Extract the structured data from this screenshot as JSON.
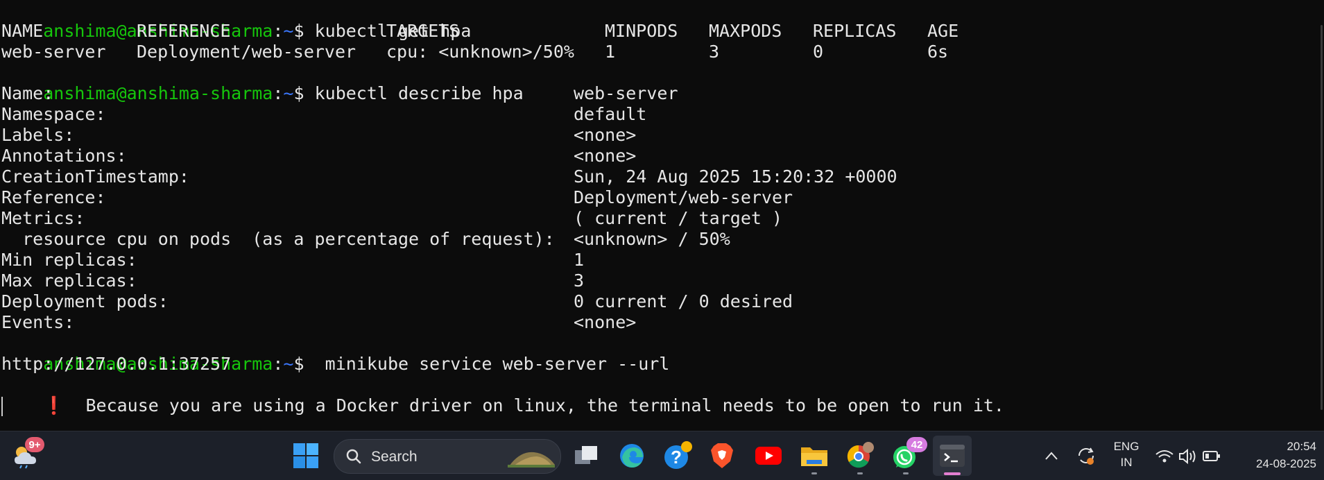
{
  "terminal": {
    "prompt_user": "anshima@anshima-sharma",
    "prompt_sep": ":",
    "prompt_path": "~",
    "prompt_dollar": "$",
    "cmd1": " kubectl get hpa",
    "hpa_table": {
      "headers": [
        "NAME",
        "REFERENCE",
        "TARGETS",
        "MINPODS",
        "MAXPODS",
        "REPLICAS",
        "AGE"
      ],
      "row": [
        "web-server",
        "Deployment/web-server",
        "cpu: <unknown>/50%",
        "1",
        "3",
        "0",
        "6s"
      ]
    },
    "cmd2": " kubectl describe hpa",
    "describe": [
      {
        "key": "Name:",
        "value": "web-server"
      },
      {
        "key": "Namespace:",
        "value": "default"
      },
      {
        "key": "Labels:",
        "value": "<none>"
      },
      {
        "key": "Annotations:",
        "value": "<none>"
      },
      {
        "key": "CreationTimestamp:",
        "value": "Sun, 24 Aug 2025 15:20:32 +0000"
      },
      {
        "key": "Reference:",
        "value": "Deployment/web-server"
      },
      {
        "key": "Metrics:",
        "value": "( current / target )"
      },
      {
        "key": "  resource cpu on pods  (as a percentage of request):",
        "value": "<unknown> / 50%"
      },
      {
        "key": "Min replicas:",
        "value": "1"
      },
      {
        "key": "Max replicas:",
        "value": "3"
      },
      {
        "key": "Deployment pods:",
        "value": "0 current / 0 desired"
      },
      {
        "key": "Events:",
        "value": "<none>"
      }
    ],
    "cmd3": "  minikube service web-server --url",
    "url_output": "http://127.0.0.1:37257",
    "warning_icon": "❗",
    "warning_text": "  Because you are using a Docker driver on linux, the terminal needs to be open to run it."
  },
  "taskbar": {
    "weather_badge": "9+",
    "search_label": "Search",
    "whatsapp_badge": "42",
    "lang_top": "ENG",
    "lang_bottom": "IN",
    "time": "20:54",
    "date": "24-08-2025"
  },
  "colors": {
    "prompt_user": "#16c60c",
    "prompt_path": "#3b78ff",
    "terminal_bg": "#0c0c0c",
    "taskbar_bg": "#1c2029"
  }
}
